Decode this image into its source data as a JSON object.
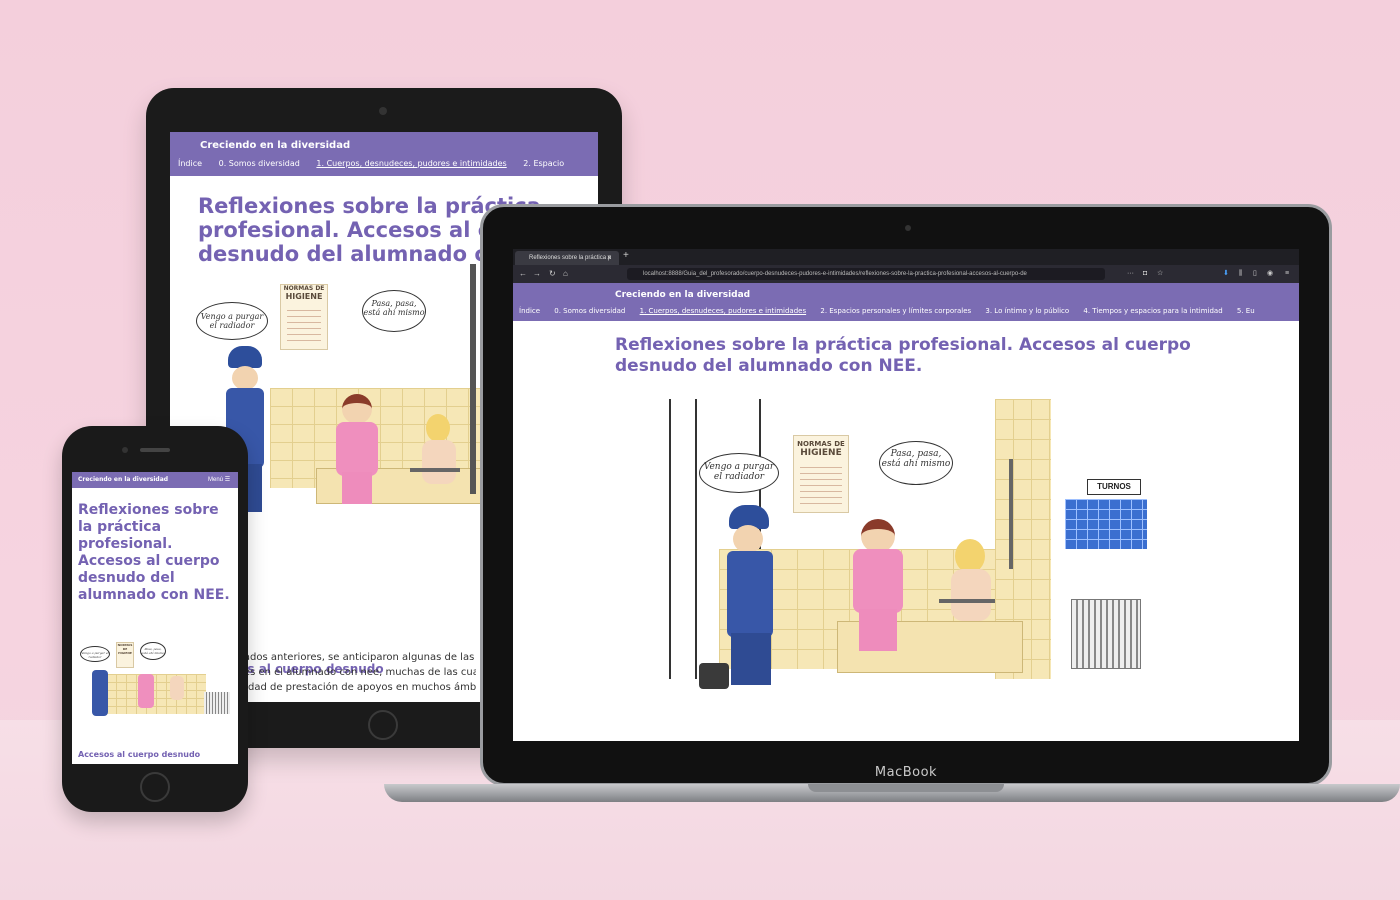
{
  "site": {
    "brand": "Creciendo en la diversidad",
    "menu_label": "Menú",
    "nav": [
      {
        "label": "Índice",
        "active": false
      },
      {
        "label": "0. Somos diversidad",
        "active": false
      },
      {
        "label": "1. Cuerpos, desnudeces, pudores e intimidades",
        "active": true
      },
      {
        "label": "2. Espacios personales y límites corporales",
        "active": false
      },
      {
        "label": "3. Lo íntimo y lo público",
        "active": false
      },
      {
        "label": "4. Tiempos y espacios para la intimidad",
        "active": false
      },
      {
        "label": "5. Eu",
        "active": false
      }
    ],
    "tablet_nav_cut": "2. Espacio"
  },
  "page": {
    "title": "Reflexiones sobre la práctica profesional. Accesos al cuerpo desnudo del alumnado con NEE.",
    "tablet_title_lines": [
      "Reflexiones sobre la práctica",
      "profesional. Accesos al cu",
      "desnudo del alumnado con"
    ],
    "laptop_title_lines": [
      "Reflexiones sobre la práctica profesional. Accesos al cuerpo",
      "desnudo del alumnado con NEE."
    ],
    "section_heading": "Accesos al cuerpo desnudo",
    "tablet_section_heading": "sos al cuerpo desnudo",
    "tablet_paragraph_lines": [
      "tados anteriores, se anticiparon algunas de las dive",
      "tes en el alumnado con nee, muchas de las cuales lle",
      "sidad de prestación de apoyos en muchos ámbitos de"
    ]
  },
  "illustration": {
    "bubble_worker": "Vengo a purgar el radiador",
    "bubble_nurse": "Pasa, pasa, está ahí mismo",
    "poster_title": "NORMAS DE",
    "poster_subtitle": "HIGIENE",
    "calendar_title": "TURNOS"
  },
  "browser": {
    "tab_title": "Reflexiones sobre la práctica p",
    "url": "localhost:8888/Guia_del_profesorado/cuerpo-desnudeces-pudores-e-intimidades/reflexiones-sobre-la-practica-profesional-accesos-al-cuerpo-de"
  },
  "device": {
    "laptop_brand": "MacBook"
  },
  "colors": {
    "accent": "#7b6cb3",
    "title": "#7462b2",
    "background": "#f4cfdc"
  }
}
